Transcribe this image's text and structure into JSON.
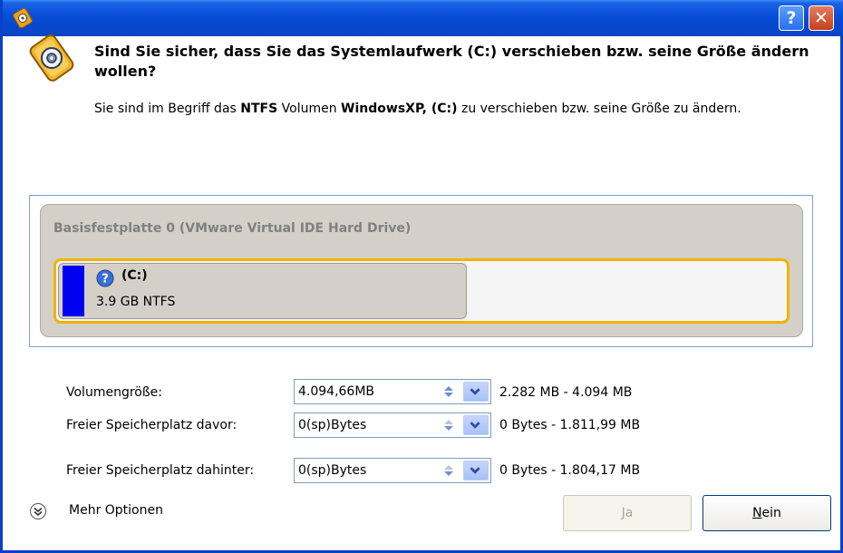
{
  "dialog": {
    "question": "Sind Sie sicher, dass Sie das Systemlaufwerk (C:) verschieben bzw. seine Größe ändern wollen?",
    "desc_prefix": "Sie sind im Begriff das ",
    "desc_fs": "NTFS",
    "desc_mid": " Volumen ",
    "desc_volume": "WindowsXP, (C:)",
    "desc_suffix": " zu verschieben bzw. seine Größe zu ändern."
  },
  "disk": {
    "title": "Basisfestplatte 0 (VMware Virtual IDE Hard Drive)",
    "partition_letter": "(C:)",
    "partition_size": "3.9 GB NTFS",
    "partition_color": "#0000f0",
    "partition_used_fraction": 0.56
  },
  "fields": [
    {
      "label": "Volumengröße:",
      "value": "4.094,66MB",
      "range": "2.282 MB - 4.094 MB"
    },
    {
      "label": "Freier Speicherplatz davor:",
      "value": "0(sp)Bytes",
      "range": "0 Bytes - 1.811,99 MB"
    },
    {
      "label": "Freier Speicherplatz dahinter:",
      "value": "0(sp)Bytes",
      "range": "0 Bytes - 1.804,17 MB"
    }
  ],
  "footer": {
    "more_options": "Mehr Optionen",
    "yes_mnemonic": "J",
    "yes_rest": "a",
    "no_mnemonic": "N",
    "no_rest": "ein"
  },
  "colors": {
    "title_bar": "#0b4fd8",
    "accent_border": "#f0b400"
  },
  "icons": {
    "app": "app-icon",
    "header": "disk-resize-icon",
    "help": "help-icon",
    "close": "close-icon",
    "partition": "question-icon",
    "more": "chevron-down-circle-icon"
  }
}
